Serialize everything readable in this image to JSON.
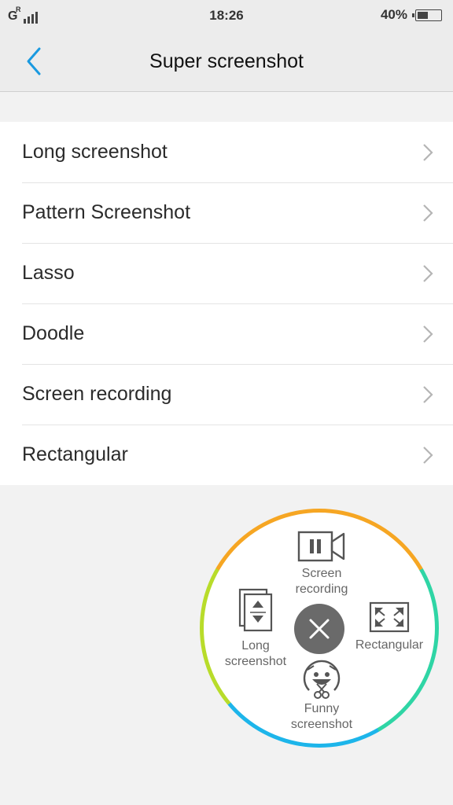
{
  "status_bar": {
    "network": "G",
    "network_sup": "R",
    "time": "18:26",
    "battery_text": "40%",
    "battery_level": 0.4
  },
  "header": {
    "title": "Super screenshot",
    "back_icon": "chevron-left-icon"
  },
  "menu": {
    "items": [
      {
        "label": "Long screenshot"
      },
      {
        "label": "Pattern Screenshot"
      },
      {
        "label": "Lasso"
      },
      {
        "label": "Doodle"
      },
      {
        "label": "Screen recording"
      },
      {
        "label": "Rectangular"
      }
    ],
    "chevron_icon": "chevron-right-icon"
  },
  "floating_panel": {
    "screen_recording_line1": "Screen",
    "screen_recording_line2": "recording",
    "long_screenshot_line1": "Long",
    "long_screenshot_line2": "screenshot",
    "rectangular": "Rectangular",
    "funny_screenshot_line1": "Funny",
    "funny_screenshot_line2": "screenshot",
    "ring_colors": [
      "#f6a623",
      "#2fd5a5",
      "#1db5ea",
      "#b8dc2a"
    ],
    "accent_color": "#1a9ae0"
  }
}
